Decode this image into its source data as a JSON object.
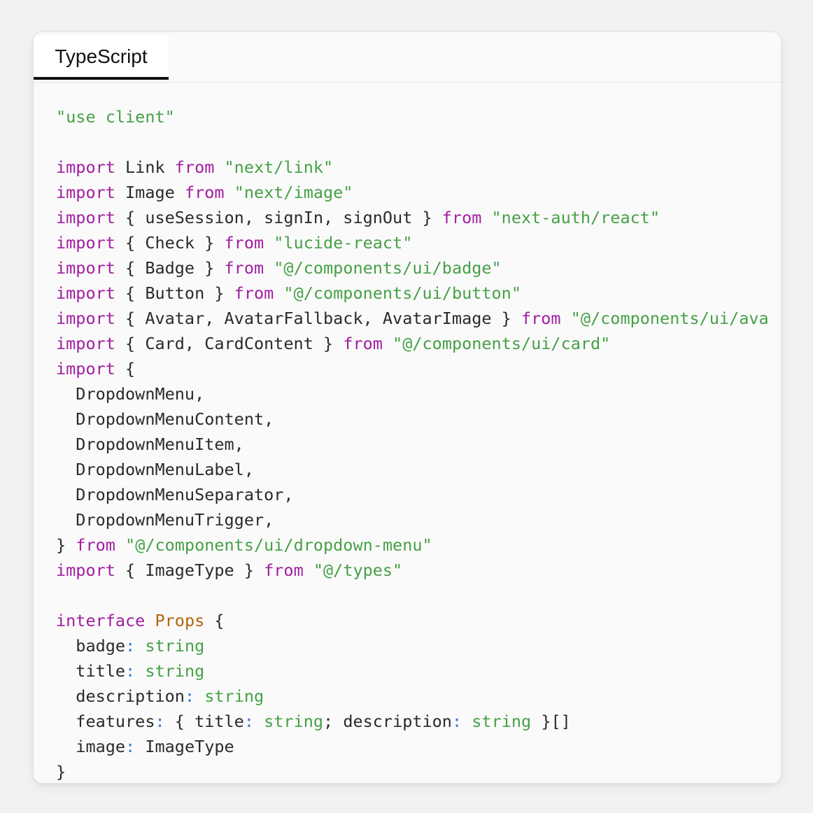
{
  "tabs": [
    {
      "label": "TypeScript",
      "active": true
    }
  ],
  "colors": {
    "keyword": "#a11ea1",
    "string": "#46a046",
    "type_name": "#b4630b",
    "punctuation": "#3a74d6",
    "plain": "#2a2a2a"
  },
  "code_lines": [
    [
      {
        "t": "str",
        "v": "\"use client\""
      }
    ],
    [],
    [
      {
        "t": "kw",
        "v": "import"
      },
      {
        "t": "pl",
        "v": " Link "
      },
      {
        "t": "kw",
        "v": "from"
      },
      {
        "t": "pl",
        "v": " "
      },
      {
        "t": "str",
        "v": "\"next/link\""
      }
    ],
    [
      {
        "t": "kw",
        "v": "import"
      },
      {
        "t": "pl",
        "v": " Image "
      },
      {
        "t": "kw",
        "v": "from"
      },
      {
        "t": "pl",
        "v": " "
      },
      {
        "t": "str",
        "v": "\"next/image\""
      }
    ],
    [
      {
        "t": "kw",
        "v": "import"
      },
      {
        "t": "pl",
        "v": " { useSession, signIn, signOut } "
      },
      {
        "t": "kw",
        "v": "from"
      },
      {
        "t": "pl",
        "v": " "
      },
      {
        "t": "str",
        "v": "\"next-auth/react\""
      }
    ],
    [
      {
        "t": "kw",
        "v": "import"
      },
      {
        "t": "pl",
        "v": " { Check } "
      },
      {
        "t": "kw",
        "v": "from"
      },
      {
        "t": "pl",
        "v": " "
      },
      {
        "t": "str",
        "v": "\"lucide-react\""
      }
    ],
    [
      {
        "t": "kw",
        "v": "import"
      },
      {
        "t": "pl",
        "v": " { Badge } "
      },
      {
        "t": "kw",
        "v": "from"
      },
      {
        "t": "pl",
        "v": " "
      },
      {
        "t": "str",
        "v": "\"@/components/ui/badge\""
      }
    ],
    [
      {
        "t": "kw",
        "v": "import"
      },
      {
        "t": "pl",
        "v": " { Button } "
      },
      {
        "t": "kw",
        "v": "from"
      },
      {
        "t": "pl",
        "v": " "
      },
      {
        "t": "str",
        "v": "\"@/components/ui/button\""
      }
    ],
    [
      {
        "t": "kw",
        "v": "import"
      },
      {
        "t": "pl",
        "v": " { Avatar, AvatarFallback, AvatarImage } "
      },
      {
        "t": "kw",
        "v": "from"
      },
      {
        "t": "pl",
        "v": " "
      },
      {
        "t": "str",
        "v": "\"@/components/ui/ava"
      }
    ],
    [
      {
        "t": "kw",
        "v": "import"
      },
      {
        "t": "pl",
        "v": " { Card, CardContent } "
      },
      {
        "t": "kw",
        "v": "from"
      },
      {
        "t": "pl",
        "v": " "
      },
      {
        "t": "str",
        "v": "\"@/components/ui/card\""
      }
    ],
    [
      {
        "t": "kw",
        "v": "import"
      },
      {
        "t": "pl",
        "v": " {"
      }
    ],
    [
      {
        "t": "pl",
        "v": "  DropdownMenu,"
      }
    ],
    [
      {
        "t": "pl",
        "v": "  DropdownMenuContent,"
      }
    ],
    [
      {
        "t": "pl",
        "v": "  DropdownMenuItem,"
      }
    ],
    [
      {
        "t": "pl",
        "v": "  DropdownMenuLabel,"
      }
    ],
    [
      {
        "t": "pl",
        "v": "  DropdownMenuSeparator,"
      }
    ],
    [
      {
        "t": "pl",
        "v": "  DropdownMenuTrigger,"
      }
    ],
    [
      {
        "t": "pl",
        "v": "} "
      },
      {
        "t": "kw",
        "v": "from"
      },
      {
        "t": "pl",
        "v": " "
      },
      {
        "t": "str",
        "v": "\"@/components/ui/dropdown-menu\""
      }
    ],
    [
      {
        "t": "kw",
        "v": "import"
      },
      {
        "t": "pl",
        "v": " { ImageType } "
      },
      {
        "t": "kw",
        "v": "from"
      },
      {
        "t": "pl",
        "v": " "
      },
      {
        "t": "str",
        "v": "\"@/types\""
      }
    ],
    [],
    [
      {
        "t": "kw",
        "v": "interface"
      },
      {
        "t": "pl",
        "v": " "
      },
      {
        "t": "ty",
        "v": "Props"
      },
      {
        "t": "pl",
        "v": " {"
      }
    ],
    [
      {
        "t": "pl",
        "v": "  badge"
      },
      {
        "t": "pn",
        "v": ":"
      },
      {
        "t": "pl",
        "v": " "
      },
      {
        "t": "str",
        "v": "string"
      }
    ],
    [
      {
        "t": "pl",
        "v": "  title"
      },
      {
        "t": "pn",
        "v": ":"
      },
      {
        "t": "pl",
        "v": " "
      },
      {
        "t": "str",
        "v": "string"
      }
    ],
    [
      {
        "t": "pl",
        "v": "  description"
      },
      {
        "t": "pn",
        "v": ":"
      },
      {
        "t": "pl",
        "v": " "
      },
      {
        "t": "str",
        "v": "string"
      }
    ],
    [
      {
        "t": "pl",
        "v": "  features"
      },
      {
        "t": "pn",
        "v": ":"
      },
      {
        "t": "pl",
        "v": " { title"
      },
      {
        "t": "pn",
        "v": ":"
      },
      {
        "t": "pl",
        "v": " "
      },
      {
        "t": "str",
        "v": "string"
      },
      {
        "t": "pl",
        "v": "; description"
      },
      {
        "t": "pn",
        "v": ":"
      },
      {
        "t": "pl",
        "v": " "
      },
      {
        "t": "str",
        "v": "string"
      },
      {
        "t": "pl",
        "v": " }[]"
      }
    ],
    [
      {
        "t": "pl",
        "v": "  image"
      },
      {
        "t": "pn",
        "v": ":"
      },
      {
        "t": "pl",
        "v": " ImageType"
      }
    ],
    [
      {
        "t": "pl",
        "v": "}"
      }
    ]
  ]
}
